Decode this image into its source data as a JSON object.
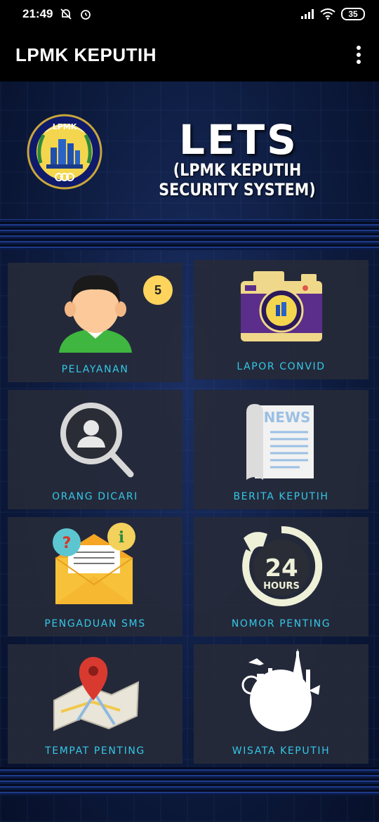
{
  "status_bar": {
    "time": "21:49",
    "icons": [
      "dnd-off-icon",
      "alarm-icon",
      "signal-icon",
      "wifi-icon"
    ],
    "battery": "35"
  },
  "app_bar": {
    "title": "LPMK KEPUTIH",
    "menu_icon": "more-vert-icon"
  },
  "header": {
    "logo_text": "LPMK",
    "title": "LETS",
    "subtitle": "(LPMK KEPUTIH SECURITY SYSTEM)"
  },
  "menu": [
    {
      "label": "PELAYANAN",
      "icon": "person-icon",
      "badge": "5"
    },
    {
      "label": "LAPOR CONVID",
      "icon": "camera-icon"
    },
    {
      "label": "ORANG DICARI",
      "icon": "magnifier-person-icon"
    },
    {
      "label": "BERITA KEPUTIH",
      "icon": "newspaper-icon",
      "icon_text": "NEWS"
    },
    {
      "label": "PENGADUAN SMS",
      "icon": "envelope-icon"
    },
    {
      "label": "NOMOR PENTING",
      "icon": "phone-24-icon",
      "icon_text": "24",
      "icon_subtext": "HOURS"
    },
    {
      "label": "TEMPAT PENTING",
      "icon": "map-pin-icon"
    },
    {
      "label": "WISATA KEPUTIH",
      "icon": "globe-landmarks-icon"
    }
  ],
  "colors": {
    "label": "#35c8e6",
    "tile_bg": "#262a3a",
    "badge": "#ffd45c"
  }
}
